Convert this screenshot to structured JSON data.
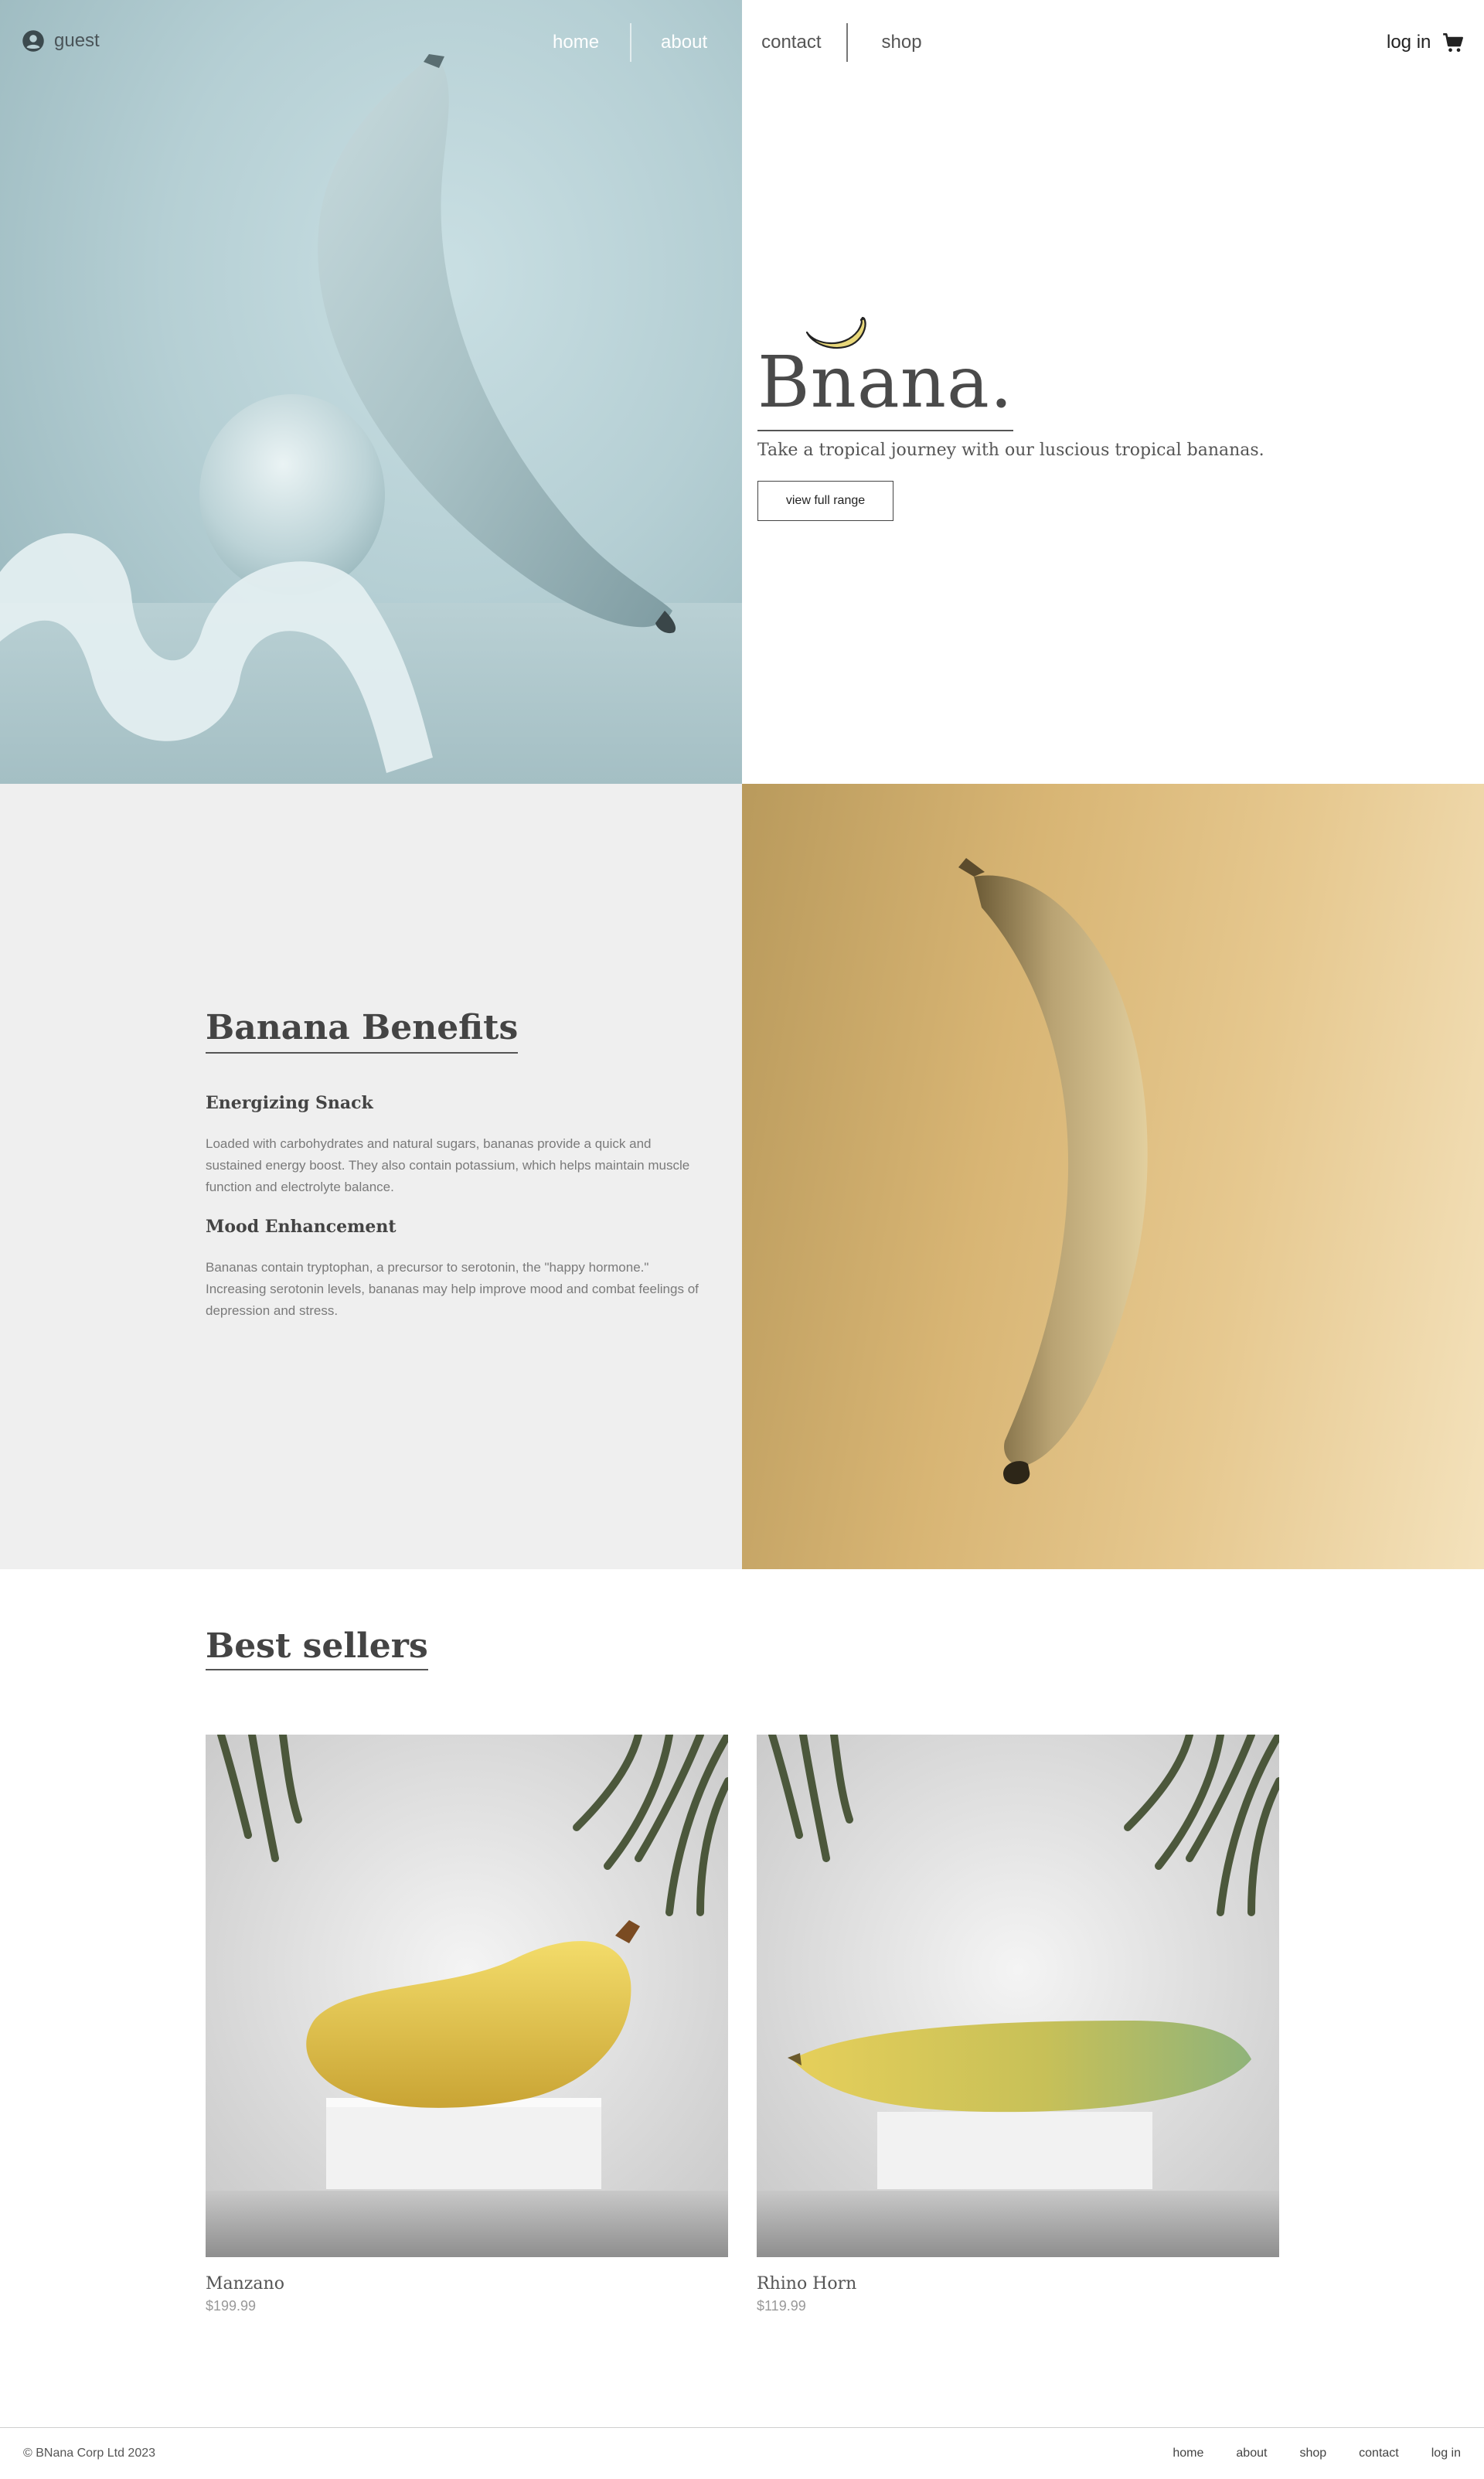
{
  "header": {
    "user_label": "guest",
    "nav": {
      "home": "home",
      "about": "about",
      "contact": "contact",
      "shop": "shop"
    },
    "login_label": "log in"
  },
  "hero": {
    "brand": "Bnana.",
    "tagline": "Take a tropical journey with our luscious tropical bananas.",
    "cta_label": "view full range"
  },
  "benefits": {
    "title": "Banana Benefits",
    "items": [
      {
        "heading": "Energizing Snack",
        "text": "Loaded with carbohydrates and natural sugars, bananas provide a quick and sustained energy boost. They also contain potassium, which helps maintain muscle function and electrolyte balance."
      },
      {
        "heading": "Mood Enhancement",
        "text": "Bananas contain tryptophan, a precursor to serotonin, the \"happy hormone.\" Increasing serotonin levels, bananas may help improve mood and combat feelings of depression and stress."
      }
    ]
  },
  "bestsellers": {
    "title": "Best sellers",
    "products": [
      {
        "name": "Manzano",
        "price": "$199.99"
      },
      {
        "name": "Rhino Horn",
        "price": "$119.99"
      }
    ]
  },
  "footer": {
    "copyright": "© BNana Corp Ltd 2023",
    "links": {
      "home": "home",
      "about": "about",
      "shop": "shop",
      "contact": "contact",
      "login": "log in"
    }
  },
  "icons": {
    "user": "user-circle-icon",
    "cart": "cart-icon",
    "logo": "banana-logo-icon"
  },
  "colors": {
    "text_dark": "#444444",
    "panel_grey": "#efefef",
    "logo_yellow": "#e8d77a"
  }
}
